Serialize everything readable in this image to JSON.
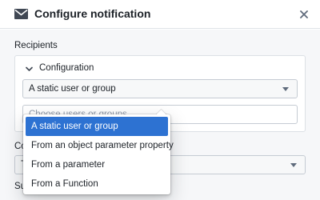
{
  "dialog": {
    "title": "Configure notification"
  },
  "recipients": {
    "section_label": "Recipients",
    "configuration_label": "Configuration",
    "type_select_value": "A static user or group",
    "users_input_placeholder": "Choose users or groups..."
  },
  "dropdown": {
    "options": [
      {
        "label": "A static user or group",
        "selected": true
      },
      {
        "label": "From an object parameter property",
        "selected": false
      },
      {
        "label": "From a parameter",
        "selected": false
      },
      {
        "label": "From a Function",
        "selected": false
      }
    ]
  },
  "partially_hidden": {
    "label_1": "Co",
    "select_value_fragment": "T",
    "label_2": "Su"
  },
  "colors": {
    "accent": "#2d72d2",
    "header_background": "#ffffff",
    "body_background": "#f6f7f9"
  }
}
